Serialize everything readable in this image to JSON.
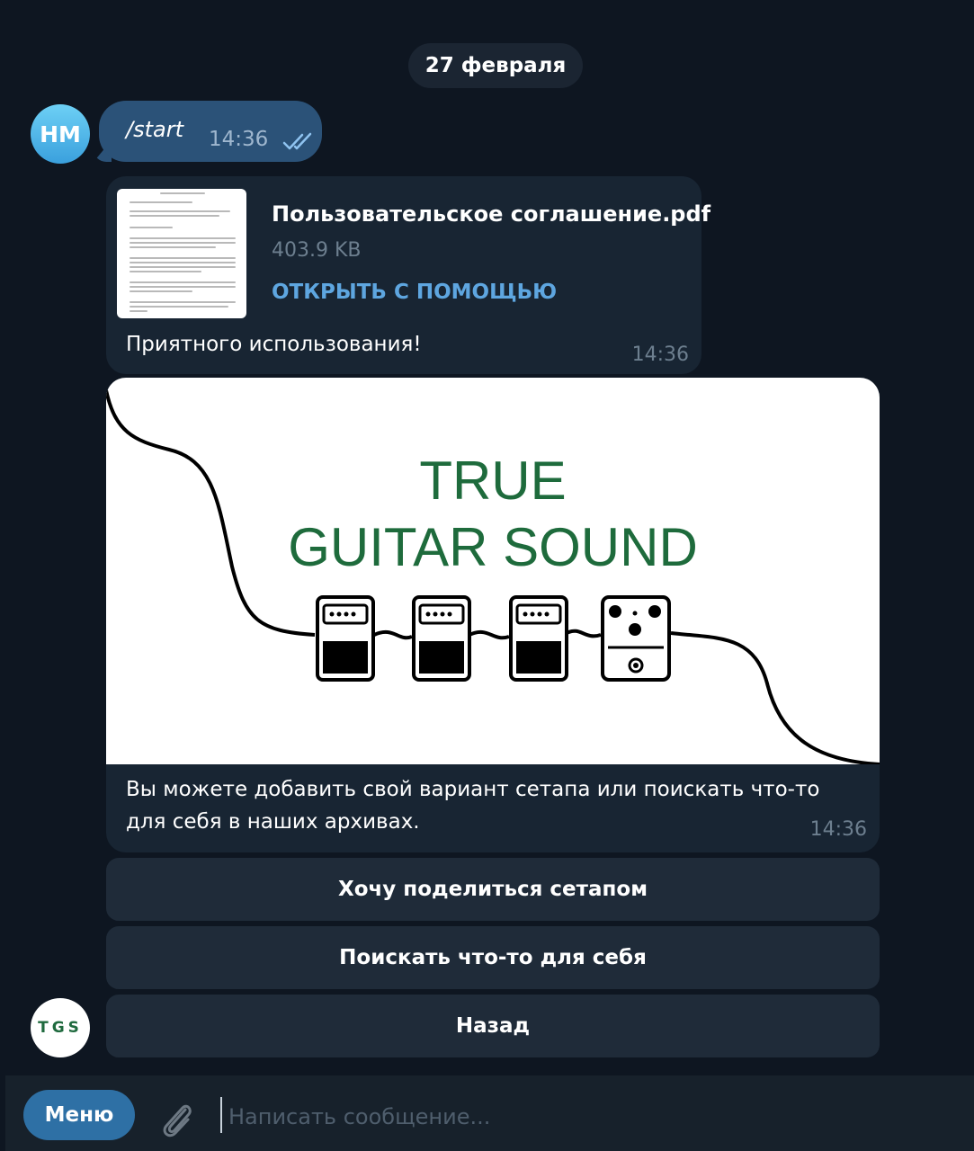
{
  "chat": {
    "date": "27 февраля",
    "user_avatar_initials": "НМ",
    "bot_avatar_initials": "TGS",
    "outgoing": {
      "text": "/start",
      "time": "14:36",
      "status_icon": "double-check-icon"
    },
    "document_message": {
      "file_name": "Пользовательское соглашение.pdf",
      "file_size": "403.9 KB",
      "open_label": "ОТКРЫТЬ С ПОМОЩЬЮ",
      "caption": "Приятного использования!",
      "time": "14:36"
    },
    "image_message": {
      "image_title_line1": "TRUE",
      "image_title_line2": "GUITAR SOUND",
      "caption": "Вы можете добавить свой вариант сетапа или поискать что-то для себя в наших архивах.",
      "time": "14:36"
    },
    "keyboard": [
      {
        "label": "Хочу поделиться сетапом"
      },
      {
        "label": "Поискать что-то для себя"
      },
      {
        "label": "Назад"
      }
    ]
  },
  "composer": {
    "menu_label": "Меню",
    "attach_icon": "paperclip-icon",
    "placeholder": "Написать сообщение..."
  },
  "colors": {
    "background": "#0e1621",
    "outgoing_bubble": "#2b5278",
    "incoming_bubble": "#182533",
    "link": "#5ea6e0",
    "brand_green": "#1e6b3c"
  }
}
